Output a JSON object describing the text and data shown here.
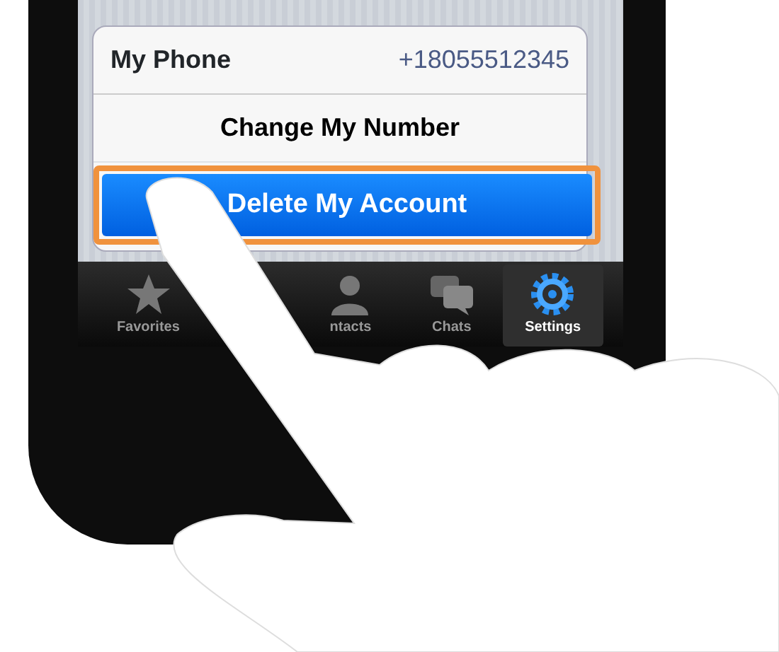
{
  "settings_rows": [
    {
      "kind": "value",
      "label": "My Phone",
      "value": "+18055512345"
    },
    {
      "kind": "action",
      "label": "Change My Number"
    },
    {
      "kind": "danger",
      "label": "Delete My Account",
      "highlighted": true
    }
  ],
  "tab_bar": [
    {
      "kind": "star",
      "label": "Favorites",
      "selected": false
    },
    {
      "kind": "person",
      "label": "ntacts",
      "selected": false
    },
    {
      "kind": "chat",
      "label": "Chats",
      "selected": false
    },
    {
      "kind": "gear",
      "label": "Settings",
      "selected": true
    }
  ]
}
